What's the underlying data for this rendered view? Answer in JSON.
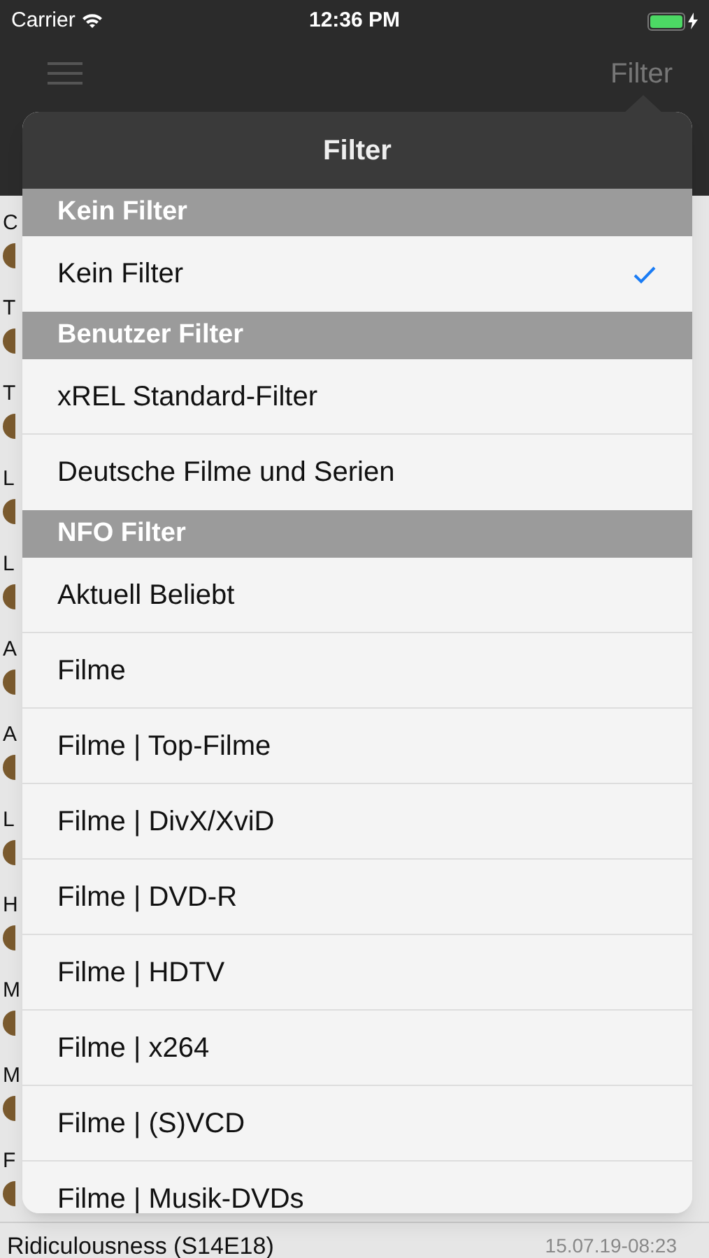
{
  "status_bar": {
    "carrier": "Carrier",
    "time": "12:36 PM"
  },
  "nav_bar": {
    "filter_button": "Filter"
  },
  "list": [
    {
      "title": "C"
    },
    {
      "title": "T"
    },
    {
      "title": "T"
    },
    {
      "title": "L"
    },
    {
      "title": "L"
    },
    {
      "title": "A"
    },
    {
      "title": "A"
    },
    {
      "title": "L"
    },
    {
      "title": "H"
    },
    {
      "title": "M"
    },
    {
      "title": "M"
    },
    {
      "title": "F"
    },
    {
      "title": "Ridiculousness (S14E18)",
      "date": "15.07.19-08:23"
    }
  ],
  "popover": {
    "title": "Filter",
    "sections": [
      {
        "header": "Kein Filter",
        "items": [
          {
            "label": "Kein Filter",
            "selected": true
          }
        ]
      },
      {
        "header": "Benutzer Filter",
        "items": [
          {
            "label": "xREL Standard-Filter",
            "selected": false
          },
          {
            "label": "Deutsche Filme und Serien",
            "selected": false
          }
        ]
      },
      {
        "header": "NFO Filter",
        "items": [
          {
            "label": "Aktuell Beliebt",
            "selected": false
          },
          {
            "label": "Filme",
            "selected": false
          },
          {
            "label": "Filme | Top-Filme",
            "selected": false
          },
          {
            "label": "Filme | DivX/XviD",
            "selected": false
          },
          {
            "label": "Filme | DVD-R",
            "selected": false
          },
          {
            "label": "Filme | HDTV",
            "selected": false
          },
          {
            "label": "Filme | x264",
            "selected": false
          },
          {
            "label": "Filme | (S)VCD",
            "selected": false
          },
          {
            "label": "Filme | Musik-DVDs",
            "selected": false
          }
        ]
      }
    ]
  }
}
